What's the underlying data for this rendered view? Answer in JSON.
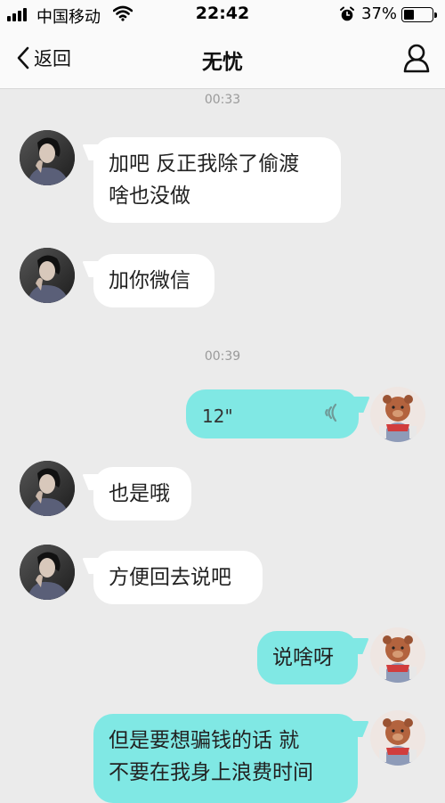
{
  "status_bar": {
    "carrier": "中国移动",
    "time": "22:42",
    "battery_percent_text": "37%",
    "battery_level": 0.37
  },
  "nav": {
    "back_label": "返回",
    "title": "无忧",
    "icons": {
      "back": "chevron-left-icon",
      "profile": "person-icon"
    }
  },
  "messages": [
    {
      "type": "timestamp",
      "text": "00:33"
    },
    {
      "type": "text",
      "side": "left",
      "lines": [
        "加吧 反正我除了偷渡",
        "啥也没做"
      ]
    },
    {
      "type": "text",
      "side": "left",
      "lines": [
        "加你微信"
      ]
    },
    {
      "type": "timestamp",
      "text": "00:39"
    },
    {
      "type": "voice",
      "side": "right",
      "duration": "12\"",
      "icon": "voice-waves-icon"
    },
    {
      "type": "text",
      "side": "left",
      "lines": [
        "也是哦"
      ]
    },
    {
      "type": "text",
      "side": "left",
      "lines": [
        "方便回去说吧"
      ]
    },
    {
      "type": "text",
      "side": "right",
      "lines": [
        "说啥呀"
      ]
    },
    {
      "type": "text",
      "side": "right",
      "lines": [
        "但是要想骗钱的话 就",
        "不要在我身上浪费时间"
      ]
    }
  ],
  "colors": {
    "incoming_bubble": "#ffffff",
    "outgoing_bubble": "#80e8e4",
    "chat_background": "#ebebeb",
    "timestamp_text": "#9a9a9a"
  }
}
